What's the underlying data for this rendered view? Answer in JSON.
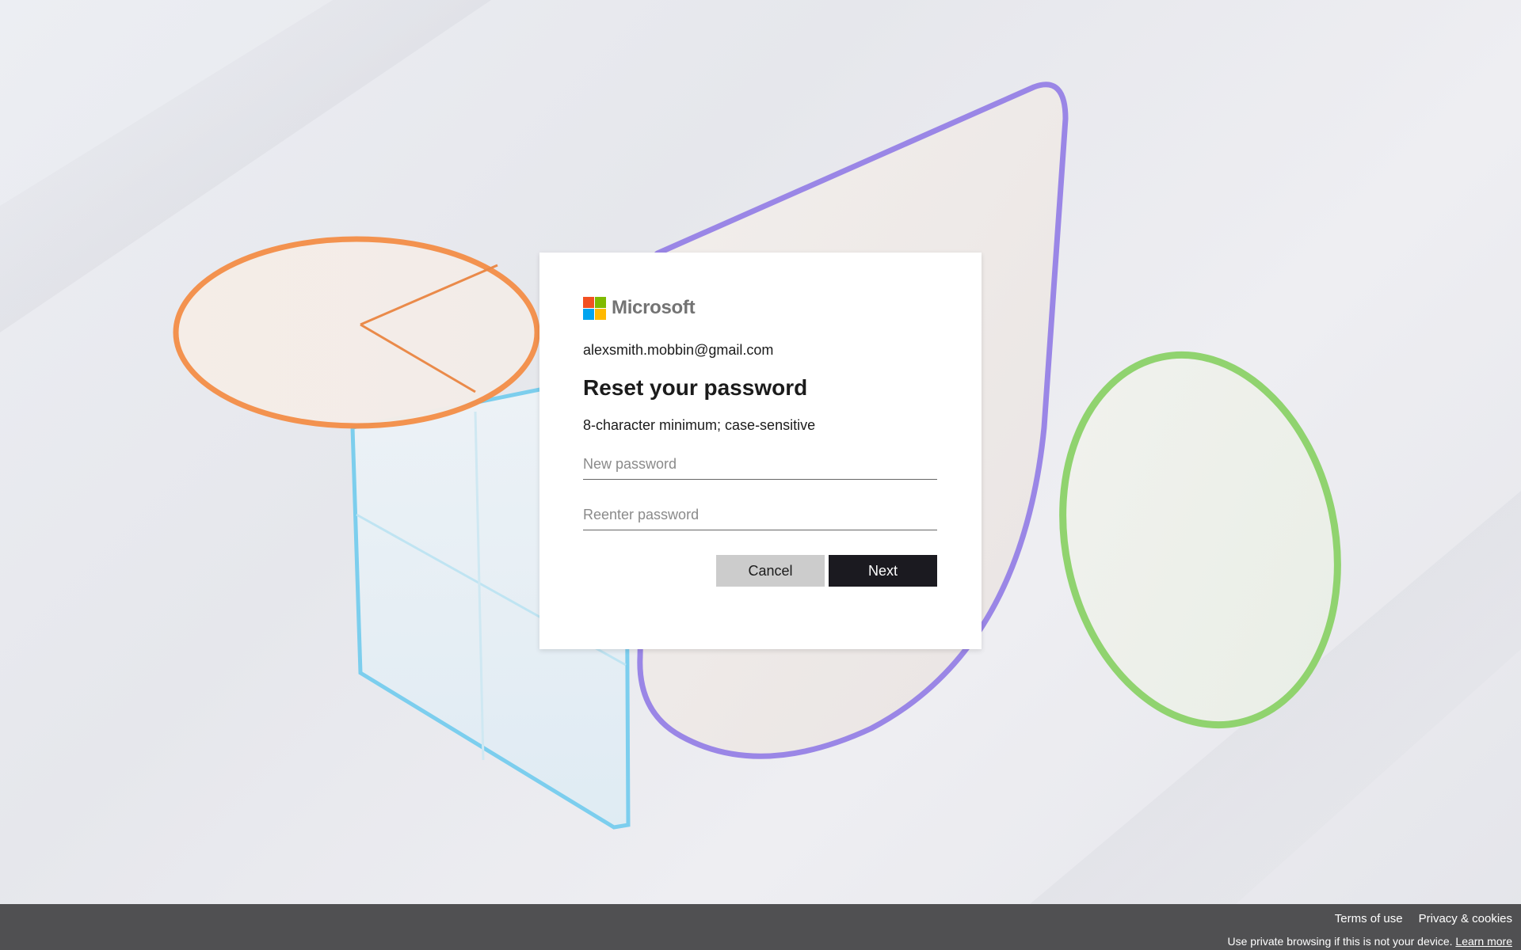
{
  "brand": {
    "name": "Microsoft",
    "colors": [
      "#f25022",
      "#7fba00",
      "#00a4ef",
      "#ffb900"
    ]
  },
  "card": {
    "identity": "alexsmith.mobbin@gmail.com",
    "title": "Reset your password",
    "hint": "8-character minimum; case-sensitive",
    "new_password": {
      "value": "",
      "placeholder": "New password"
    },
    "reenter_password": {
      "value": "",
      "placeholder": "Reenter password"
    },
    "cancel_label": "Cancel",
    "next_label": "Next"
  },
  "footer": {
    "terms_label": "Terms of use",
    "privacy_label": "Privacy & cookies",
    "note_text": "Use private browsing if this is not your device.",
    "learn_more_label": "Learn more"
  },
  "colors": {
    "primary_button": "#1b1a20",
    "secondary_button": "#cccccc",
    "footer_bg": "#505052"
  }
}
